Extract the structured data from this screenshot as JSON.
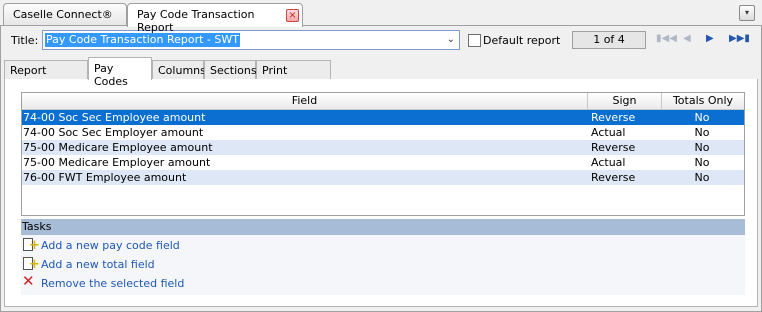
{
  "doc_tabs": [
    {
      "label": "Caselle Connect®"
    },
    {
      "label": "Pay Code Transaction Report",
      "close": "×"
    }
  ],
  "tab_menu_icon": "▾",
  "title_row": {
    "label": "Title:",
    "value": "Pay Code Transaction Report - SWT",
    "dropdown_icon": "chevron-down-icon",
    "default_report_label": "Default report",
    "default_report_checked": false,
    "page_indicator": "1 of 4"
  },
  "section_tabs": [
    {
      "label": "Report Options"
    },
    {
      "label": "Pay Codes",
      "active": true
    },
    {
      "label": "Columns"
    },
    {
      "label": "Sections"
    },
    {
      "label": "Print Settings"
    }
  ],
  "grid": {
    "columns": [
      "Field",
      "Sign",
      "Totals Only"
    ],
    "rows": [
      {
        "field": "74-00 Soc Sec Employee amount",
        "sign": "Reverse",
        "totals_only": "No",
        "selected": true
      },
      {
        "field": "74-00 Soc Sec Employer amount",
        "sign": "Actual",
        "totals_only": "No"
      },
      {
        "field": "75-00 Medicare Employee amount",
        "sign": "Reverse",
        "totals_only": "No"
      },
      {
        "field": "75-00 Medicare Employer amount",
        "sign": "Actual",
        "totals_only": "No"
      },
      {
        "field": "76-00 FWT Employee amount",
        "sign": "Reverse",
        "totals_only": "No"
      }
    ]
  },
  "tasks": {
    "header": "Tasks",
    "items": [
      {
        "label": "Add a new pay code field",
        "icon": "add-document-icon"
      },
      {
        "label": "Add a new total field",
        "icon": "add-document-icon"
      },
      {
        "label": "Remove the selected field",
        "icon": "red-x-icon"
      }
    ]
  },
  "colors": {
    "selection": "#0a6fd0",
    "alt_row": "#dde7f5",
    "tasks_header": "#a7bcd6",
    "link": "#1f57b6"
  }
}
